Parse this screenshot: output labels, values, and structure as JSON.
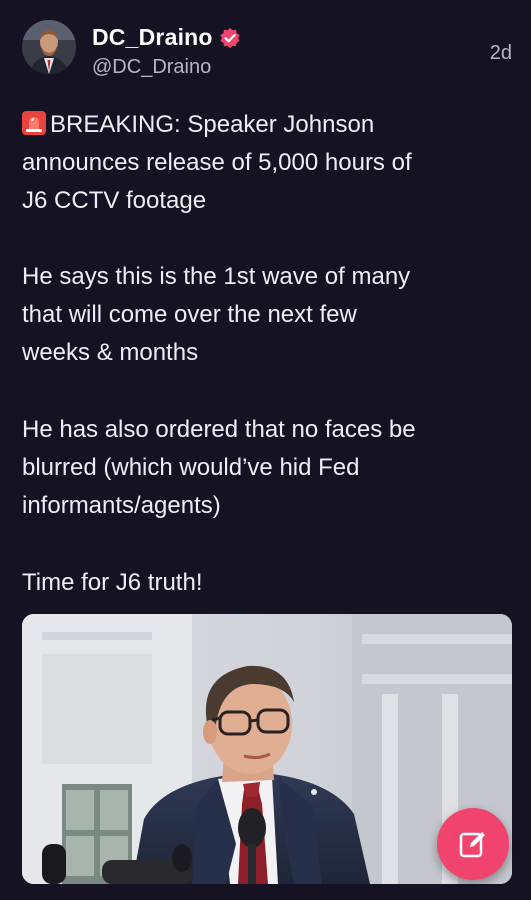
{
  "post": {
    "author": {
      "name": "DC_Draino",
      "handle": "@DC_Draino",
      "verified": true,
      "verified_color": "#f0446e",
      "avatar_icon": "avatar-photo"
    },
    "timestamp": "2d",
    "paragraphs": {
      "p1_prefix_icon": "rotating-light-icon",
      "p1_line1": "BREAKING: Speaker Johnson",
      "p1_line2": "announces release of 5,000 hours of",
      "p1_line3": "J6 CCTV footage",
      "p2_line1": "He says this is the 1st wave of many",
      "p2_line2": "that will come over the next few",
      "p2_line3": "weeks & months",
      "p3_line1": "He has also ordered that no faces be",
      "p3_line2": "blurred (which would’ve hid Fed",
      "p3_line3": "informants/agents)",
      "p4_line1": "Time for J6 truth!"
    },
    "media": {
      "kind": "photo",
      "subject": "man in suit with glasses at microphones"
    }
  },
  "compose": {
    "icon": "compose-icon",
    "color": "#f0446e"
  },
  "colors": {
    "background": "#151224",
    "text": "#eeedf4",
    "secondary_text": "#b8b5c8"
  }
}
